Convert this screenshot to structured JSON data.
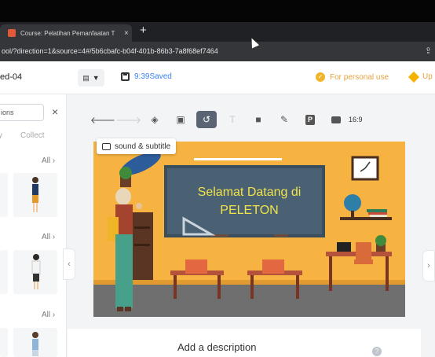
{
  "browser": {
    "tab_title": "Course: Pelatihan Pemanfaatan T",
    "tab_close": "×",
    "new_tab": "+",
    "url": "ool/?direction=1&source=4#/5b6cbafc-b04f-401b-86b3-7a8f68ef7464"
  },
  "header": {
    "project_name": "ed-04",
    "save_status": "9:39Saved",
    "personal_use": "For personal use",
    "upgrade": "Up"
  },
  "left_panel": {
    "search_placeholder": "ions",
    "close": "×",
    "tabs": [
      "y",
      "Collect"
    ],
    "all_label": "All",
    "collapse": "‹"
  },
  "toolbar": {
    "tools": [
      {
        "icon": "undo-icon",
        "glyph": "🡐"
      },
      {
        "icon": "redo-icon",
        "glyph": "🡒"
      },
      {
        "icon": "layers-icon",
        "glyph": "◈"
      },
      {
        "icon": "background-icon",
        "glyph": "▣"
      },
      {
        "icon": "link-icon",
        "glyph": "↺"
      },
      {
        "icon": "text-icon",
        "glyph": "T"
      },
      {
        "icon": "camera-icon",
        "glyph": "■"
      },
      {
        "icon": "pen-icon",
        "glyph": "✎"
      },
      {
        "icon": "p-icon",
        "glyph": "P"
      },
      {
        "icon": "rect-icon",
        "glyph": ""
      }
    ],
    "ratio": "16:9"
  },
  "canvas": {
    "sound_button": "sound & subtitle",
    "board_line1": "Selamat Datang di",
    "board_line2": "PELETON",
    "colors": {
      "wall": "#f6b342",
      "board": "#496173",
      "floor": "#6f6f70",
      "table": "#b4523b"
    }
  },
  "description": "Add a description",
  "right_collapse": "›"
}
